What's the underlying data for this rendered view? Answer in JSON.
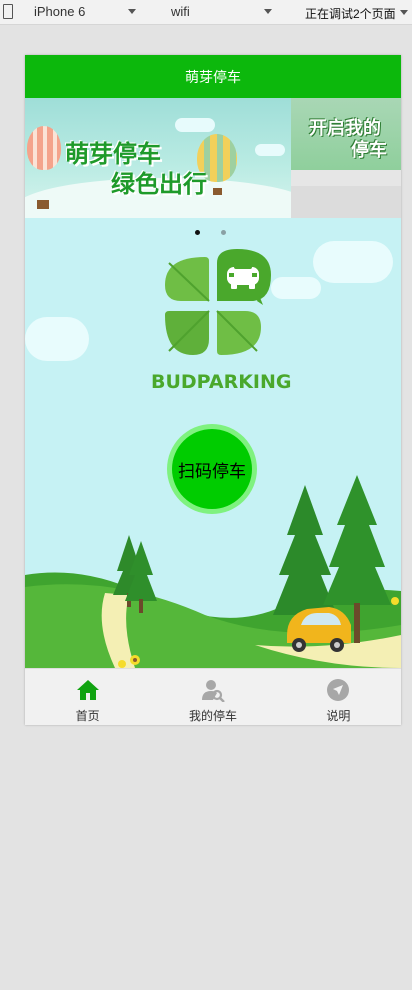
{
  "devtools": {
    "device": "iPhone 6",
    "network": "wifi",
    "status": "正在调试2个页面"
  },
  "app": {
    "title": "萌芽停车",
    "brand": "BUDPARKING",
    "scan_button_label": "扫码停车"
  },
  "banner": {
    "slide1_line1": "萌芽停车",
    "slide1_line2": "绿色出行",
    "slide2_line1": "开启我的",
    "slide2_line2": "停车",
    "active_index": 0,
    "total": 2
  },
  "tabs": [
    {
      "label": "首页",
      "icon": "home-icon",
      "active": true
    },
    {
      "label": "我的停车",
      "icon": "user-search-icon",
      "active": false
    },
    {
      "label": "说明",
      "icon": "navigation-icon",
      "active": false
    }
  ],
  "colors": {
    "header": "#0cb80c",
    "active_tab": "#11a311",
    "inactive_tab": "#a7a7a7",
    "scan_button": "#00cc00",
    "background": "#c6f2f4"
  }
}
